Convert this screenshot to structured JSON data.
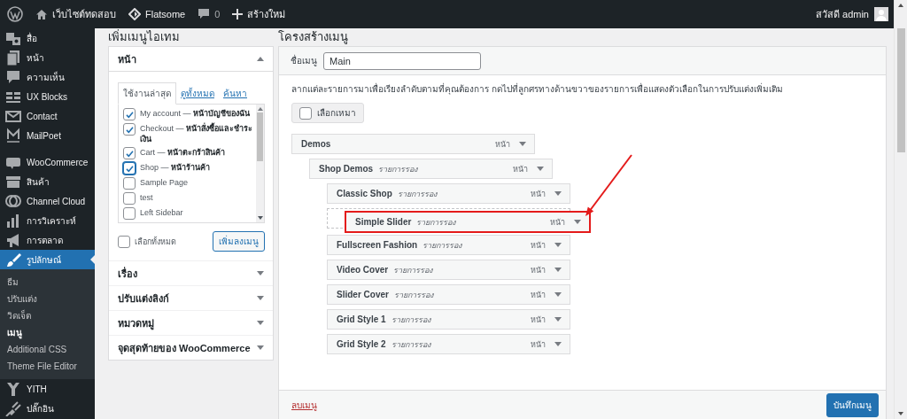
{
  "admin_bar": {
    "site_name": "เว็บไซต์ทดสอบ",
    "theme": "Flatsome",
    "comments": "0",
    "new_label": "สร้างใหม่",
    "greeting": "สวัสดี admin"
  },
  "sidebar": {
    "groups": [
      [
        {
          "label": "สื่อ",
          "selected": false
        },
        {
          "label": "หน้า",
          "selected": false
        },
        {
          "label": "ความเห็น",
          "selected": false
        },
        {
          "label": "UX Blocks",
          "selected": false
        },
        {
          "label": "Contact",
          "selected": false
        },
        {
          "label": "MailPoet",
          "selected": false
        }
      ],
      [
        {
          "label": "WooCommerce",
          "selected": false
        },
        {
          "label": "สินค้า",
          "selected": false
        },
        {
          "label": "Channel Cloud",
          "selected": false
        },
        {
          "label": "การวิเคราะห์",
          "selected": false
        },
        {
          "label": "การตลาด",
          "selected": false
        },
        {
          "label": "รูปลักษณ์",
          "selected": true,
          "submenu": [
            {
              "label": "ธีม",
              "selected": false
            },
            {
              "label": "ปรับแต่ง",
              "selected": false
            },
            {
              "label": "วิดเจ็ต",
              "selected": false
            },
            {
              "label": "เมนู",
              "selected": true
            },
            {
              "label": "Additional CSS",
              "selected": false
            },
            {
              "label": "Theme File Editor",
              "selected": false
            }
          ]
        },
        {
          "label": "YITH",
          "selected": false
        },
        {
          "label": "ปลั๊กอิน",
          "selected": false
        }
      ]
    ]
  },
  "add_items": {
    "title": "เพิ่มเมนูไอเทม",
    "sections": [
      {
        "title": "หน้า",
        "expanded": true,
        "tabs": [
          {
            "label": "ใช้งานล่าสุด",
            "selected": true
          },
          {
            "label": "ดูทั้งหมด",
            "selected": false
          },
          {
            "label": "ค้นหา",
            "selected": false
          }
        ],
        "items": [
          {
            "label": "My account — **หน้าบัญชีของฉัน**",
            "checked": true
          },
          {
            "label": "Checkout — **หน้าสั่งซื้อและชำระเงิน**",
            "checked": true
          },
          {
            "label": "Cart — **หน้าตะกร้าสินค้า**",
            "checked": true
          },
          {
            "label": "Shop — **หน้าร้านค้า**",
            "checked": true
          },
          {
            "label": "Sample Page",
            "checked": false
          },
          {
            "label": "test",
            "checked": false
          },
          {
            "label": "Left Sidebar",
            "checked": false
          }
        ],
        "select_all": {
          "label": "เลือกทั้งหมด",
          "checked": false
        },
        "add_button": "เพิ่มลงเมนู"
      },
      {
        "title": "เรื่อง",
        "expanded": false
      },
      {
        "title": "ปรับแต่งลิงก์",
        "expanded": false
      },
      {
        "title": "หมวดหมู่",
        "expanded": false
      },
      {
        "title": "จุดสุดท้ายของ WooCommerce",
        "expanded": false
      }
    ]
  },
  "menu_structure": {
    "title": "โครงสร้างเมนู",
    "name_label": "ชื่อเมนู",
    "name_value": "Main",
    "instructions": "ลากแต่ละรายการมาเพื่อเรียงลำดับตามที่คุณต้องการ กดไปที่ลูกศรทางด้านขวาของรายการเพื่อแสดงตัวเลือกในการปรับแต่งเพิ่มเติม",
    "bulk_select": {
      "label": "เลือกเหมา",
      "checked": false
    },
    "items": [
      {
        "title": "Demos",
        "type": "หน้า",
        "dragging": false,
        "annotated": false,
        "children": [
          {
            "title": "Shop Demos",
            "subtitle": "รายการรอง",
            "type": "หน้า",
            "dragging": false,
            "annotated": false,
            "children": [
              {
                "title": "Classic Shop",
                "subtitle": "รายการรอง",
                "type": "หน้า",
                "dragging": false,
                "annotated": false
              },
              {
                "title": "Simple Slider",
                "subtitle": "รายการรอง",
                "type": "หน้า",
                "dragging": true,
                "annotated": true
              },
              {
                "title": "Fullscreen Fashion",
                "subtitle": "รายการรอง",
                "type": "หน้า",
                "dragging": false,
                "annotated": false
              },
              {
                "title": "Video Cover",
                "subtitle": "รายการรอง",
                "type": "หน้า",
                "dragging": false,
                "annotated": false
              },
              {
                "title": "Slider Cover",
                "subtitle": "รายการรอง",
                "type": "หน้า",
                "dragging": false,
                "annotated": false
              },
              {
                "title": "Grid Style 1",
                "subtitle": "รายการรอง",
                "type": "หน้า",
                "dragging": false,
                "annotated": false
              },
              {
                "title": "Grid Style 2",
                "subtitle": "รายการรอง",
                "type": "หน้า",
                "dragging": false,
                "annotated": false
              }
            ]
          }
        ]
      }
    ],
    "delete_link": "ลบเมนู",
    "save_button": "บันทึกเมนู"
  }
}
